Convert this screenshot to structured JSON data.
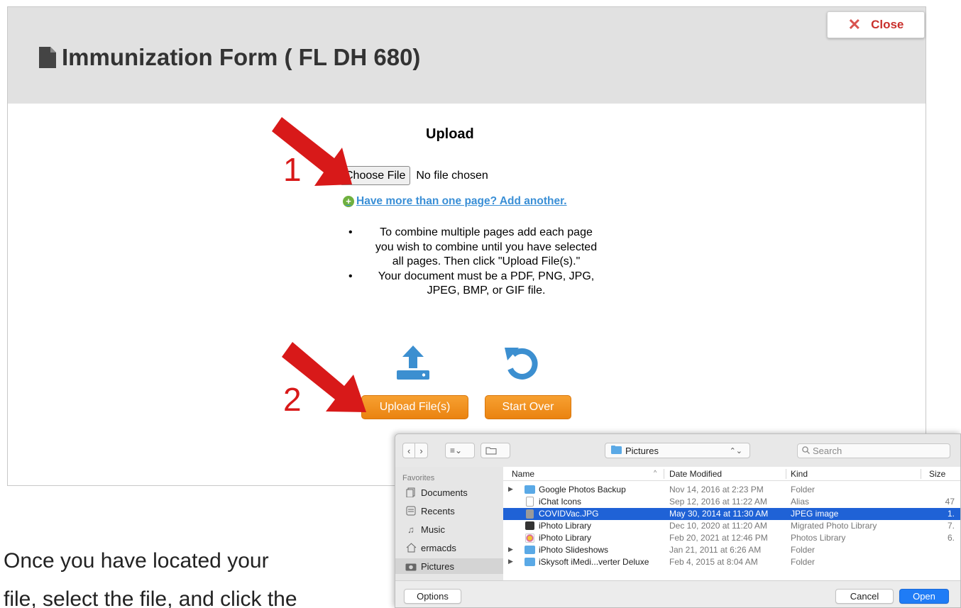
{
  "form": {
    "title": "Immunization Form ( FL DH 680)",
    "close_label": "Close",
    "upload_heading": "Upload",
    "choose_file_label": "Choose File",
    "no_file_text": "No file chosen",
    "add_another": "Have more than one page? Add another.",
    "instructions": [
      "To combine multiple pages add each page you wish to combine until you have selected all pages. Then click \"Upload File(s).\"",
      "Your document must be a PDF, PNG, JPG, JPEG, BMP, or GIF file."
    ],
    "upload_button": "Upload File(s)",
    "start_over_button": "Start Over",
    "accent_color": "#ea8311",
    "link_color": "#3a8fd6"
  },
  "annotations": {
    "step1": "1",
    "step2": "2",
    "arrow_color": "#d81919"
  },
  "caption": {
    "line1": "Once you have located your",
    "line2": "file, select the file, and click the"
  },
  "dialog": {
    "location": "Pictures",
    "search_placeholder": "Search",
    "sidebar_heading": "Favorites",
    "sidebar_items": [
      "Documents",
      "Recents",
      "Music",
      "ermacds",
      "Pictures"
    ],
    "columns": [
      "Name",
      "Date Modified",
      "Kind",
      "Size"
    ],
    "rows": [
      {
        "name": "Google Photos Backup",
        "date": "Nov 14, 2016 at 2:23 PM",
        "kind": "Folder",
        "size": ""
      },
      {
        "name": "iChat Icons",
        "date": "Sep 12, 2016 at 11:22 AM",
        "kind": "Alias",
        "size": "47"
      },
      {
        "name": "COVIDVac.JPG",
        "date": "May 30, 2014 at 11:30 AM",
        "kind": "JPEG image",
        "size": "1."
      },
      {
        "name": "iPhoto Library",
        "date": "Dec 10, 2020 at 11:20 AM",
        "kind": "Migrated Photo Library",
        "size": "7."
      },
      {
        "name": "iPhoto Library",
        "date": "Feb 20, 2021 at 12:46 PM",
        "kind": "Photos Library",
        "size": "6."
      },
      {
        "name": "iPhoto Slideshows",
        "date": "Jan 21, 2011 at 6:26 AM",
        "kind": "Folder",
        "size": ""
      },
      {
        "name": "iSkysoft iMedi...verter Deluxe",
        "date": "Feb 4, 2015 at 8:04 AM",
        "kind": "Folder",
        "size": ""
      }
    ],
    "options_button": "Options",
    "cancel_button": "Cancel",
    "open_button": "Open",
    "selection_color": "#1f62d6"
  }
}
